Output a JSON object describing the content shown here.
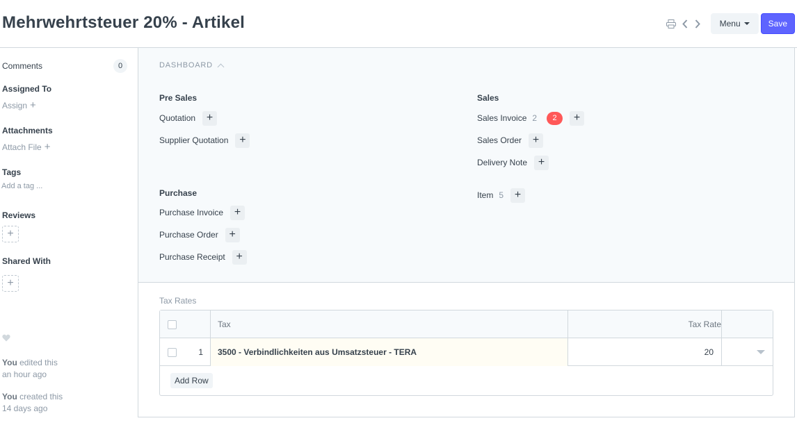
{
  "header": {
    "title": "Mehrwehrtsteuer 20% - Artikel",
    "menu_label": "Menu",
    "save_label": "Save",
    "icons": [
      "printer-icon",
      "chevron-left-icon",
      "chevron-right-icon"
    ]
  },
  "sidebar": {
    "comments_label": "Comments",
    "comments_count": "0",
    "assigned_to": "Assigned To",
    "assign": "Assign",
    "attachments": "Attachments",
    "attach_file": "Attach File",
    "tags": "Tags",
    "add_tag": "Add a tag ...",
    "reviews": "Reviews",
    "shared_with": "Shared With",
    "activity": [
      {
        "user": "You",
        "action": "edited this",
        "time": "an hour ago"
      },
      {
        "user": "You",
        "action": "created this",
        "time": "14 days ago"
      }
    ]
  },
  "dashboard": {
    "title": "DASHBOARD",
    "groups": {
      "pre_sales": {
        "label": "Pre Sales",
        "items": [
          {
            "label": "Quotation"
          },
          {
            "label": "Supplier Quotation"
          }
        ]
      },
      "sales": {
        "label": "Sales",
        "items": [
          {
            "label": "Sales Invoice",
            "count": "2",
            "badge": "2"
          },
          {
            "label": "Sales Order"
          },
          {
            "label": "Delivery Note"
          }
        ]
      },
      "purchase": {
        "label": "Purchase",
        "items": [
          {
            "label": "Purchase Invoice"
          },
          {
            "label": "Purchase Order"
          },
          {
            "label": "Purchase Receipt"
          }
        ]
      },
      "item": {
        "items": [
          {
            "label": "Item",
            "count": "5"
          }
        ]
      }
    }
  },
  "tax_rates": {
    "label": "Tax Rates",
    "columns": {
      "tax": "Tax",
      "rate": "Tax Rate"
    },
    "rows": [
      {
        "idx": "1",
        "tax": "3500 - Verbindlichkeiten aus Umsatzsteuer - TERA",
        "rate": "20"
      }
    ],
    "add_row": "Add Row"
  },
  "colors": {
    "primary": "#5e64ff",
    "badge_red": "#ff5858",
    "text": "#36414c",
    "muted": "#8d99a6"
  }
}
